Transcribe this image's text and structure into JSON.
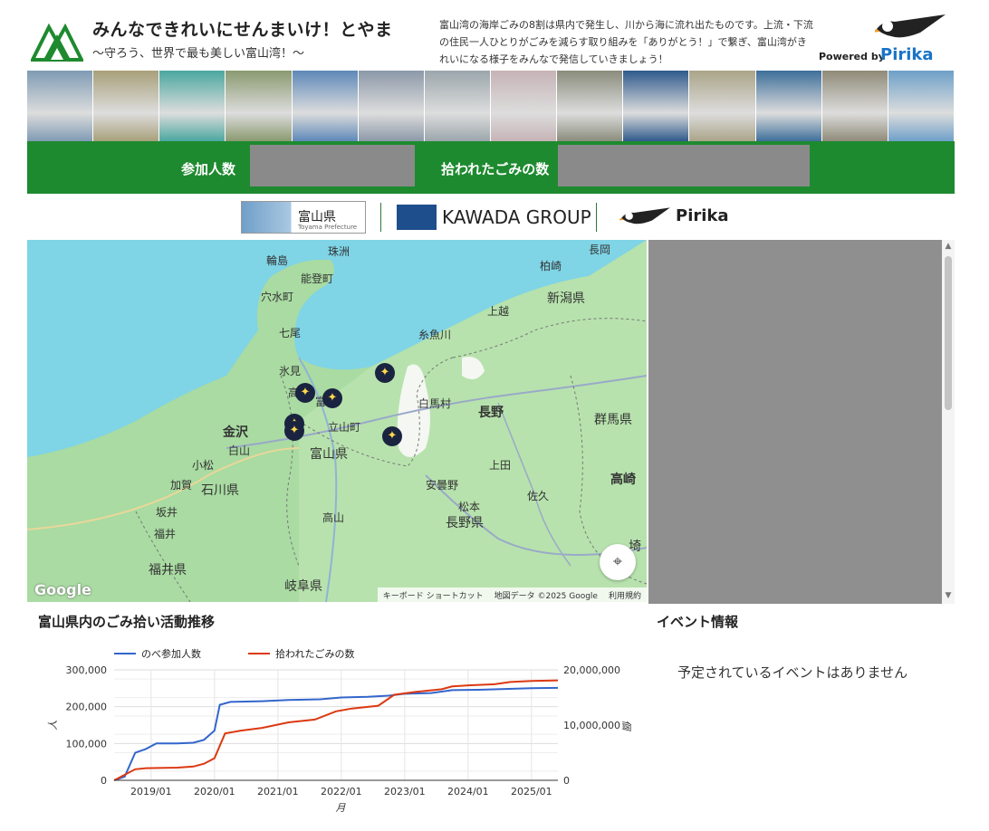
{
  "header": {
    "title": "みんなできれいにせんまいけ！とやま",
    "subtitle": "〜守ろう、世界で最も美しい富山湾！〜",
    "description": "富山湾の海岸ごみの8割は県内で発生し、川から海に流れ出たものです。上流・下流の住民一人ひとりがごみを減らす取り組みを「ありがとう！」で繋ぎ、富山湾がきれいになる様子をみんなで発信していきましょう！",
    "powered_by": "Powered by",
    "powered_name": "Pirika"
  },
  "photos": [
    "#7f9bb4",
    "#a8a07a",
    "#4aa7a0",
    "#8a9a70",
    "#5e88b8",
    "#8c98a8",
    "#9ba6ac",
    "#c6b3b6",
    "#8a8c7c",
    "#2f5a8c",
    "#aaa488",
    "#3e6f9a",
    "#8f8a78",
    "#6ea0c8"
  ],
  "stats": {
    "participants_label": "参加人数",
    "trash_label": "拾われたごみの数"
  },
  "sponsors": {
    "toyama": "富山県",
    "toyama_en": "Toyama Prefecture",
    "kawada": "KAWADA GROUP",
    "pirika": "Pirika"
  },
  "map": {
    "labels": {
      "wajima": "輪島",
      "suzu": "珠洲",
      "noto": "能登町",
      "anamizu": "穴水町",
      "nanao": "七尾",
      "himi": "氷見",
      "taka": "高",
      "tomi": "富",
      "kanazawa": "金沢",
      "hakusan": "白山",
      "komatsu": "小松",
      "kaga": "加賀",
      "ishikawa": "石川県",
      "sakai": "坂井",
      "fukui": "福井",
      "fukui_pref": "福井県",
      "tateyama": "立山町",
      "toyama_pref": "富山県",
      "takayama": "高山",
      "gifu": "岐阜県",
      "itoigawa": "糸魚川",
      "hakuba": "白馬村",
      "nagano": "長野",
      "azumino": "安曇野",
      "matsumoto": "松本",
      "nagano_pref": "長野県",
      "ueda": "上田",
      "saku": "佐久",
      "joetsu": "上越",
      "niigata_pref": "新潟県",
      "nagaoka": "長岡",
      "kashiwazaki": "柏崎",
      "gunma": "群馬県",
      "takasaki": "高崎",
      "sai": "埼"
    },
    "google": "Google",
    "attr_keyboard": "キーボード ショートカット",
    "attr_data": "地図データ ©2025 Google",
    "attr_terms": "利用規約",
    "pin_icon": "✦"
  },
  "chart_title": "富山県内のごみ拾い活動推移",
  "events": {
    "title": "イベント情報",
    "none": "予定されているイベントはありません"
  },
  "chart_data": {
    "type": "line",
    "xlabel": "月",
    "ylabel_left": "人",
    "ylabel_right": "個",
    "x_ticks": [
      "2019/01",
      "2020/01",
      "2021/01",
      "2022/01",
      "2023/01",
      "2024/01",
      "2025/01"
    ],
    "y_left_ticks": [
      "300,000",
      "200,000",
      "100,000",
      "0"
    ],
    "y_right_ticks": [
      "20,000,000",
      "10,000,000",
      "0"
    ],
    "y_left_range": [
      0,
      300000
    ],
    "y_right_range": [
      0,
      20000000
    ],
    "x_range": [
      "2018/06",
      "2025/06"
    ],
    "series": [
      {
        "name": "のべ参加人数",
        "axis": "left",
        "color": "#3366cc",
        "points": [
          [
            "2018/06",
            0
          ],
          [
            "2018/08",
            10000
          ],
          [
            "2018/10",
            75000
          ],
          [
            "2018/12",
            85000
          ],
          [
            "2019/02",
            100000
          ],
          [
            "2019/06",
            100000
          ],
          [
            "2019/09",
            102000
          ],
          [
            "2019/11",
            110000
          ],
          [
            "2020/01",
            135000
          ],
          [
            "2020/02",
            205000
          ],
          [
            "2020/04",
            213000
          ],
          [
            "2020/10",
            215000
          ],
          [
            "2021/03",
            218000
          ],
          [
            "2021/09",
            220000
          ],
          [
            "2022/01",
            225000
          ],
          [
            "2022/06",
            227000
          ],
          [
            "2022/10",
            230000
          ],
          [
            "2023/01",
            235000
          ],
          [
            "2023/06",
            237000
          ],
          [
            "2023/10",
            245000
          ],
          [
            "2024/03",
            246000
          ],
          [
            "2024/08",
            248000
          ],
          [
            "2025/01",
            250000
          ],
          [
            "2025/06",
            251000
          ]
        ]
      },
      {
        "name": "拾われたごみの数",
        "axis": "right",
        "color": "#dc3912",
        "points": [
          [
            "2018/06",
            0
          ],
          [
            "2018/08",
            1000000
          ],
          [
            "2018/10",
            2000000
          ],
          [
            "2018/12",
            2200000
          ],
          [
            "2019/06",
            2300000
          ],
          [
            "2019/09",
            2500000
          ],
          [
            "2019/11",
            3000000
          ],
          [
            "2020/01",
            4000000
          ],
          [
            "2020/03",
            8500000
          ],
          [
            "2020/06",
            9000000
          ],
          [
            "2020/10",
            9500000
          ],
          [
            "2021/03",
            10500000
          ],
          [
            "2021/08",
            11000000
          ],
          [
            "2021/12",
            12500000
          ],
          [
            "2022/03",
            13000000
          ],
          [
            "2022/08",
            13500000
          ],
          [
            "2022/11",
            15500000
          ],
          [
            "2023/03",
            16000000
          ],
          [
            "2023/08",
            16500000
          ],
          [
            "2023/10",
            17000000
          ],
          [
            "2024/01",
            17200000
          ],
          [
            "2024/06",
            17400000
          ],
          [
            "2024/09",
            17800000
          ],
          [
            "2025/01",
            18000000
          ],
          [
            "2025/06",
            18100000
          ]
        ]
      }
    ]
  }
}
